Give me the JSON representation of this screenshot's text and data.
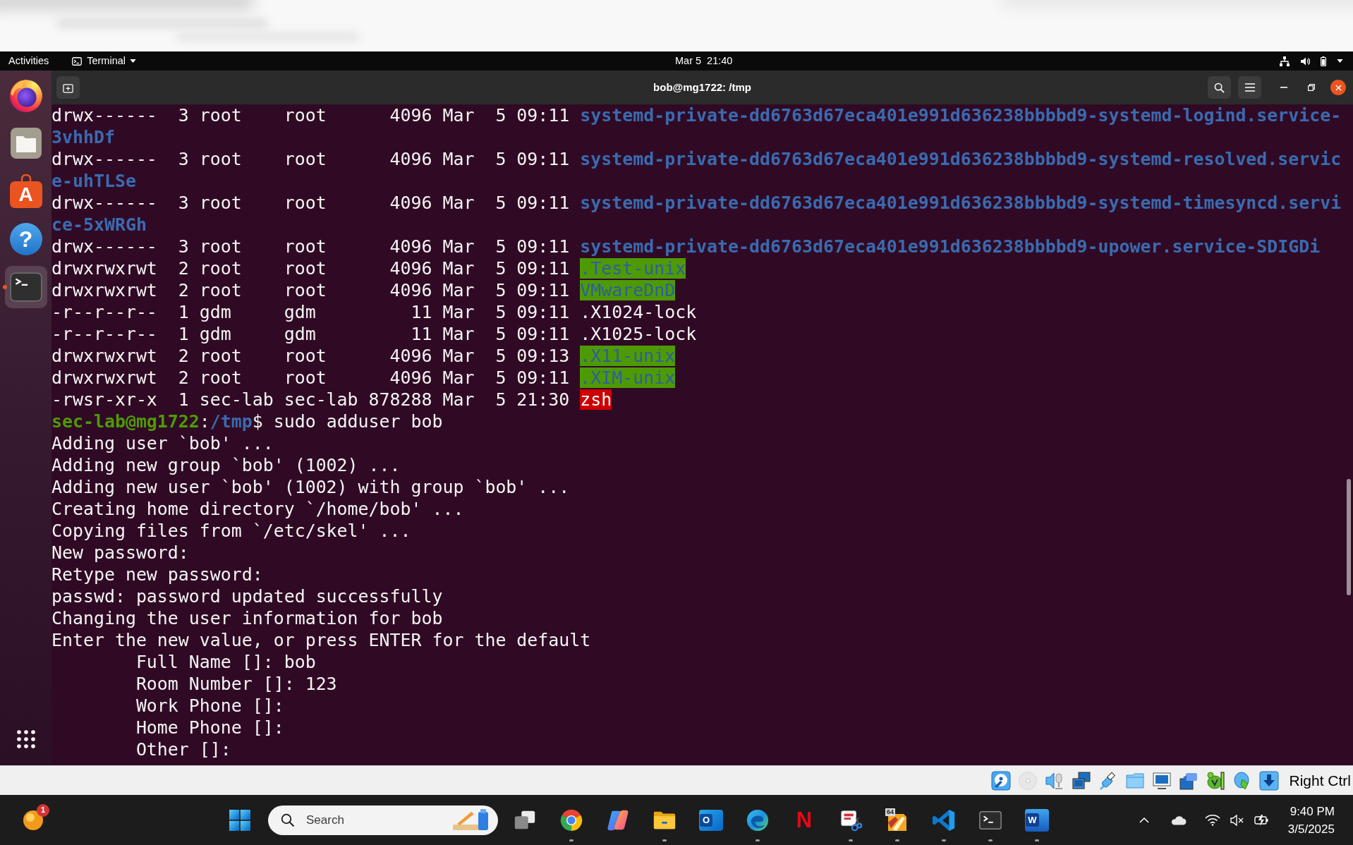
{
  "gnome_top_bar": {
    "activities": "Activities",
    "app_menu": "Terminal",
    "clock": "Mar 5  21:40"
  },
  "dock": {
    "items": [
      {
        "kind": "browser",
        "running": false,
        "selected": false
      },
      {
        "kind": "files",
        "running": false,
        "selected": false
      },
      {
        "kind": "store",
        "glyph": "A",
        "running": false,
        "selected": false
      },
      {
        "kind": "help",
        "glyph": "?",
        "running": false,
        "selected": false
      },
      {
        "kind": "terminal",
        "running": true,
        "selected": true
      }
    ]
  },
  "terminal": {
    "title": "bob@mg1722: /tmp",
    "listing": [
      {
        "permissions": "drwx------",
        "links": "3",
        "owner": "root",
        "group": "root",
        "size": "4096",
        "month": "Mar",
        "day": "5",
        "time": "09:11",
        "name": "systemd-private-dd6763d67eca401e991d636238bbbbd9-systemd-logind.service-3vhhDf",
        "kind": "dir"
      },
      {
        "permissions": "drwx------",
        "links": "3",
        "owner": "root",
        "group": "root",
        "size": "4096",
        "month": "Mar",
        "day": "5",
        "time": "09:11",
        "name": "systemd-private-dd6763d67eca401e991d636238bbbbd9-systemd-resolved.service-uhTLSe",
        "kind": "dir"
      },
      {
        "permissions": "drwx------",
        "links": "3",
        "owner": "root",
        "group": "root",
        "size": "4096",
        "month": "Mar",
        "day": "5",
        "time": "09:11",
        "name": "systemd-private-dd6763d67eca401e991d636238bbbbd9-systemd-timesyncd.service-5xWRGh",
        "kind": "dir"
      },
      {
        "permissions": "drwx------",
        "links": "3",
        "owner": "root",
        "group": "root",
        "size": "4096",
        "month": "Mar",
        "day": "5",
        "time": "09:11",
        "name": "systemd-private-dd6763d67eca401e991d636238bbbbd9-upower.service-SDIGDi",
        "kind": "dir"
      },
      {
        "permissions": "drwxrwxrwt",
        "links": "2",
        "owner": "root",
        "group": "root",
        "size": "4096",
        "month": "Mar",
        "day": "5",
        "time": "09:11",
        "name": ".Test-unix",
        "kind": "sticky"
      },
      {
        "permissions": "drwxrwxrwt",
        "links": "2",
        "owner": "root",
        "group": "root",
        "size": "4096",
        "month": "Mar",
        "day": "5",
        "time": "09:11",
        "name": "VMwareDnD",
        "kind": "sticky"
      },
      {
        "permissions": "-r--r--r--",
        "links": "1",
        "owner": "gdm",
        "group": "gdm",
        "size": "11",
        "month": "Mar",
        "day": "5",
        "time": "09:11",
        "name": ".X1024-lock",
        "kind": "file"
      },
      {
        "permissions": "-r--r--r--",
        "links": "1",
        "owner": "gdm",
        "group": "gdm",
        "size": "11",
        "month": "Mar",
        "day": "5",
        "time": "09:11",
        "name": ".X1025-lock",
        "kind": "file"
      },
      {
        "permissions": "drwxrwxrwt",
        "links": "2",
        "owner": "root",
        "group": "root",
        "size": "4096",
        "month": "Mar",
        "day": "5",
        "time": "09:13",
        "name": ".X11-unix",
        "kind": "sticky"
      },
      {
        "permissions": "drwxrwxrwt",
        "links": "2",
        "owner": "root",
        "group": "root",
        "size": "4096",
        "month": "Mar",
        "day": "5",
        "time": "09:11",
        "name": ".XIM-unix",
        "kind": "sticky"
      },
      {
        "permissions": "-rwsr-xr-x",
        "links": "1",
        "owner": "sec-lab",
        "group": "sec-lab",
        "size": "878288",
        "month": "Mar",
        "day": "5",
        "time": "21:30",
        "name": "zsh",
        "kind": "setuid"
      }
    ],
    "prompt": {
      "user_host": "sec-lab@mg1722",
      "separator": ":",
      "path": "/tmp",
      "symbol": "$",
      "command": "sudo adduser bob"
    },
    "output": [
      {
        "text": "Adding user `bob' ...",
        "indented": false
      },
      {
        "text": "Adding new group `bob' (1002) ...",
        "indented": false
      },
      {
        "text": "Adding new user `bob' (1002) with group `bob' ...",
        "indented": false
      },
      {
        "text": "Creating home directory `/home/bob' ...",
        "indented": false
      },
      {
        "text": "Copying files from `/etc/skel' ...",
        "indented": false
      },
      {
        "text": "New password:",
        "indented": false
      },
      {
        "text": "Retype new password:",
        "indented": false
      },
      {
        "text": "passwd: password updated successfully",
        "indented": false
      },
      {
        "text": "Changing the user information for bob",
        "indented": false
      },
      {
        "text": "Enter the new value, or press ENTER for the default",
        "indented": false
      },
      {
        "text": "Full Name []: bob",
        "indented": true
      },
      {
        "text": "Room Number []: 123",
        "indented": true
      },
      {
        "text": "Work Phone []:",
        "indented": true
      },
      {
        "text": "Home Phone []:",
        "indented": true
      },
      {
        "text": "Other []:",
        "indented": true
      }
    ]
  },
  "vm_status_bar": {
    "indicators": [
      {
        "kind": "hard_disk",
        "active": true
      },
      {
        "kind": "optical",
        "active": false
      },
      {
        "kind": "audio",
        "active": true
      },
      {
        "kind": "network",
        "active": true
      },
      {
        "kind": "usb",
        "active": true
      },
      {
        "kind": "shared_folders",
        "active": true
      },
      {
        "kind": "display",
        "active": true
      },
      {
        "kind": "capture",
        "active": true
      },
      {
        "kind": "turtle",
        "active": true
      },
      {
        "kind": "mouse",
        "active": true
      },
      {
        "kind": "keyboard",
        "active": true
      }
    ],
    "host_key": "Right Ctrl"
  },
  "taskbar": {
    "widgets_badge": "1",
    "search": {
      "placeholder": "Search"
    },
    "apps": [
      {
        "kind": "task_view",
        "running": false
      },
      {
        "kind": "chrome",
        "running": true
      },
      {
        "kind": "copilot",
        "running": false
      },
      {
        "kind": "explorer",
        "running": true
      },
      {
        "kind": "outlook",
        "glyph": "O",
        "running": false
      },
      {
        "kind": "edge",
        "running": true
      },
      {
        "kind": "netflix",
        "glyph": "N",
        "running": false
      },
      {
        "kind": "snipping",
        "running": true
      },
      {
        "kind": "app64",
        "label": "64",
        "running": true
      },
      {
        "kind": "vscode",
        "running": true
      },
      {
        "kind": "terminal",
        "running": true
      },
      {
        "kind": "word",
        "glyph": "W",
        "running": true
      }
    ],
    "clock": {
      "time": "9:40 PM",
      "date": "3/5/2025"
    }
  }
}
